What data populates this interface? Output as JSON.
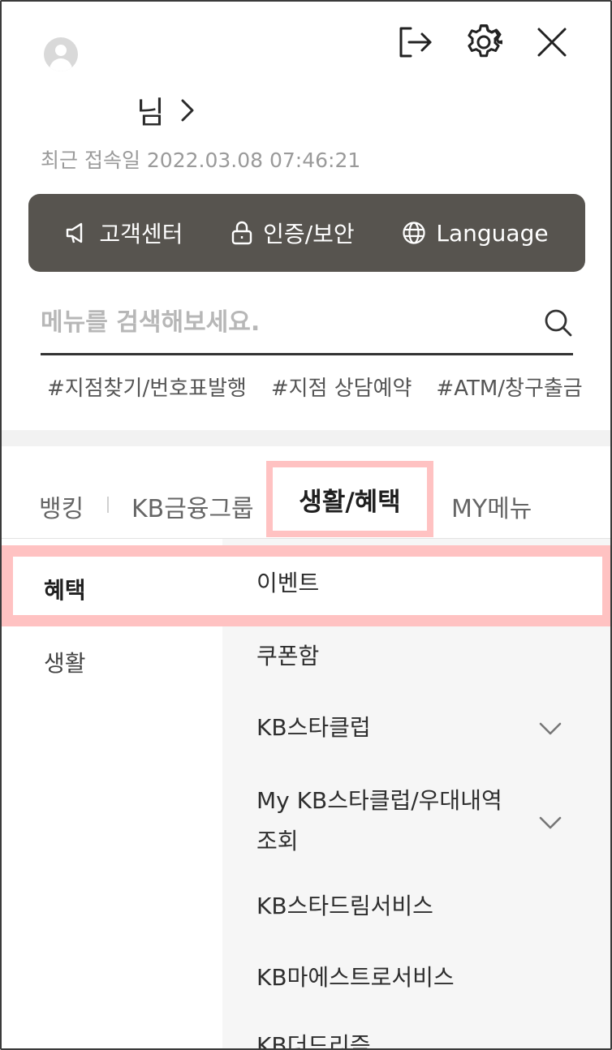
{
  "header": {
    "user_suffix": "님",
    "last_login_label": "최근 접속일",
    "last_login_value": "2022.03.08 07:46:21"
  },
  "quick_menu": [
    {
      "label": "고객센터",
      "icon": "megaphone-icon"
    },
    {
      "label": "인증/보안",
      "icon": "lock-icon"
    },
    {
      "label": "Language",
      "icon": "globe-icon"
    }
  ],
  "search": {
    "placeholder": "메뉴를 검색해보세요."
  },
  "tags": [
    "#지점찾기/번호표발행",
    "#지점 상담예약",
    "#ATM/창구출금"
  ],
  "tabs": [
    {
      "label": "뱅킹"
    },
    {
      "label": "KB금융그룹"
    },
    {
      "label": "생활/혜택"
    },
    {
      "label": "MY메뉴"
    }
  ],
  "categories": [
    {
      "label": "혜택"
    },
    {
      "label": "생활"
    }
  ],
  "submenu": [
    {
      "label": "이벤트"
    },
    {
      "label": "쿠폰함"
    },
    {
      "label": "KB스타클럽"
    },
    {
      "label": "My KB스타클럽/우대내역"
    },
    {
      "label": "조회"
    },
    {
      "label": "KB스타드림서비스"
    },
    {
      "label": "KB마에스트로서비스"
    },
    {
      "label": "KB더드리즘"
    }
  ]
}
